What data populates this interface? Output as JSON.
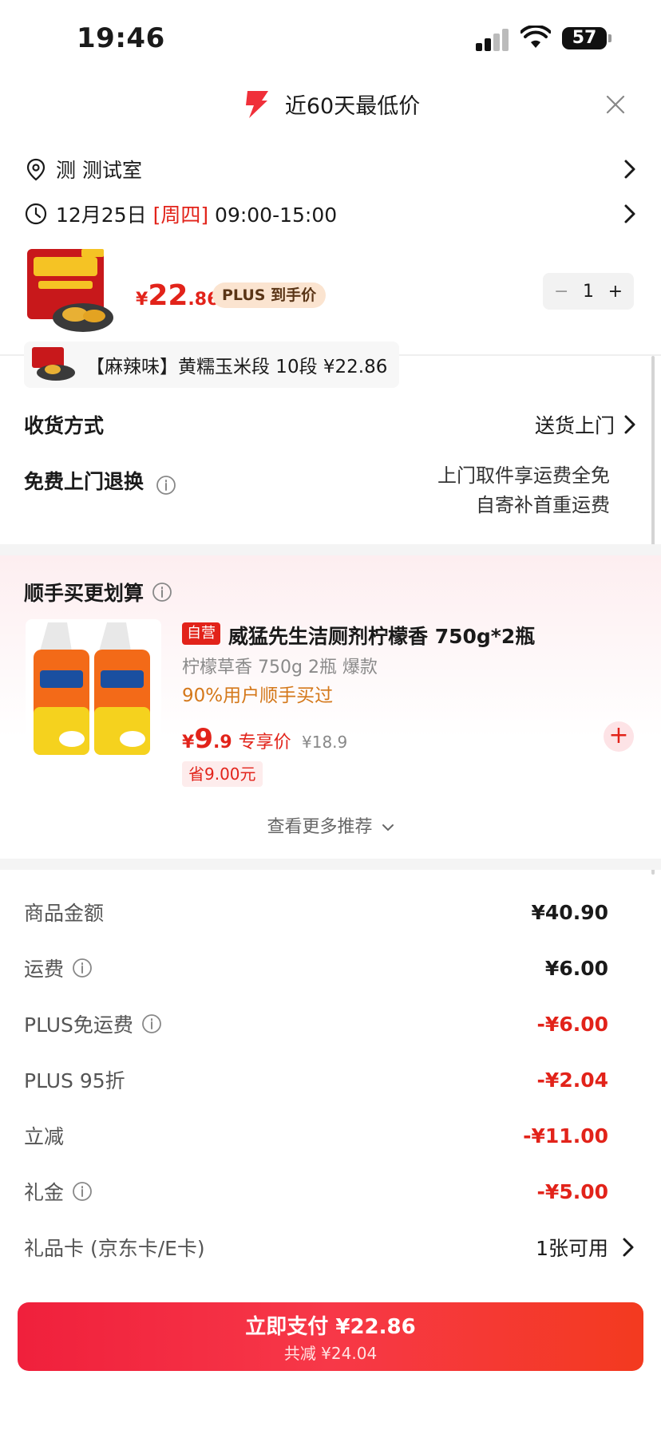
{
  "status_bar": {
    "time": "19:46",
    "battery": "57"
  },
  "header": {
    "title": "近60天最低价"
  },
  "address": {
    "text": "测 测试室"
  },
  "delivery_time": {
    "date": "12月25日",
    "weekday": "[周四]",
    "window": "09:00-15:00"
  },
  "product": {
    "price_currency": "¥",
    "price_int": "22",
    "price_dec": ".86",
    "plus_badge": "PLUS 到手价",
    "qty_minus": "−",
    "quantity": "1",
    "qty_plus": "+"
  },
  "variant": {
    "text": "【麻辣味】黄糯玉米段 10段  ¥22.86"
  },
  "shipping": {
    "label": "收货方式",
    "value": "送货上门"
  },
  "returns": {
    "label": "免费上门退换",
    "line1": "上门取件享运费全免",
    "line2": "自寄补首重运费"
  },
  "recommend": {
    "title": "顺手买更划算",
    "self_badge": "自营",
    "name": "威猛先生洁厕剂柠檬香 750g*2瓶",
    "spec": "柠檬草香 750g 2瓶 爆款",
    "hint": "90%用户顺手买过",
    "price_currency": "¥",
    "price_int": "9",
    "price_dec": ".9",
    "price_tag": "专享价",
    "orig_price": "¥18.9",
    "save": "省9.00元",
    "add": "+",
    "more": "查看更多推荐"
  },
  "summary": [
    {
      "label": "商品金额",
      "value": "¥40.90",
      "info": false,
      "red": false
    },
    {
      "label": "运费",
      "value": "¥6.00",
      "info": true,
      "red": false
    },
    {
      "label": "PLUS免运费",
      "value": "-¥6.00",
      "info": true,
      "red": true
    },
    {
      "label": "PLUS 95折",
      "value": "-¥2.04",
      "info": false,
      "red": true
    },
    {
      "label": "立减",
      "value": "-¥11.00",
      "info": false,
      "red": true
    },
    {
      "label": "礼金",
      "value": "-¥5.00",
      "info": true,
      "red": true
    },
    {
      "label": "礼品卡 (京东卡/E卡)",
      "value": "1张可用",
      "info": false,
      "red": false
    }
  ],
  "pay": {
    "main": "立即支付 ¥22.86",
    "sub": "共减 ¥24.04"
  },
  "colors": {
    "accent": "#e2231a",
    "pay_gradient_start": "#f0203c",
    "pay_gradient_end": "#f33a1f"
  }
}
